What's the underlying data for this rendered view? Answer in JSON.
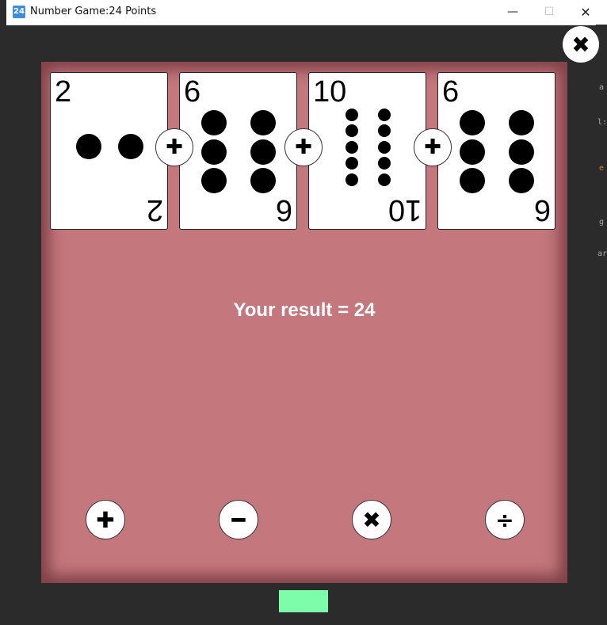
{
  "window": {
    "icon_text": "24",
    "title": "Number Game:24 Points",
    "minimize": "—",
    "maximize": "☐",
    "close": "✕"
  },
  "side_fragments": [
    "a",
    "l:",
    "e",
    "g",
    "ar"
  ],
  "close_button_glyph": "✖",
  "cards": [
    {
      "rank": "2"
    },
    {
      "rank": "6"
    },
    {
      "rank": "10"
    },
    {
      "rank": "6"
    }
  ],
  "between_ops": [
    "✚",
    "✚",
    "✚"
  ],
  "result": "Your result = 24",
  "operator_buttons": [
    {
      "name": "add",
      "glyph": "✚"
    },
    {
      "name": "subtract",
      "glyph": "━"
    },
    {
      "name": "multiply",
      "glyph": "✖"
    },
    {
      "name": "divide",
      "glyph": "÷"
    }
  ],
  "colors": {
    "board": "#c4777d",
    "background": "#2b2b2b",
    "confirm_button": "#7dfca9"
  }
}
